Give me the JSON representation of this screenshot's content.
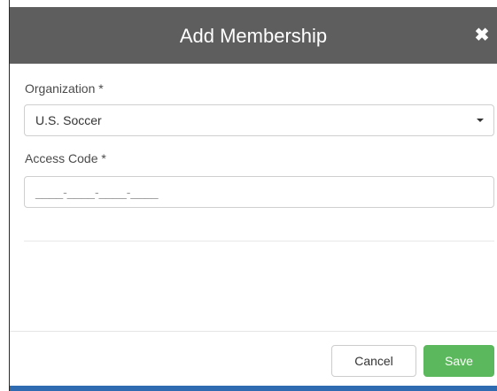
{
  "modal": {
    "title": "Add Membership",
    "close_glyph": "✖",
    "close_icon": "close-icon"
  },
  "form": {
    "organization": {
      "label": "Organization *",
      "selected_value": "U.S. Soccer",
      "caret_icon": "caret-down-icon"
    },
    "access_code": {
      "label": "Access Code *",
      "mask": "____-____-____-____",
      "value": ""
    }
  },
  "footer": {
    "cancel_label": "Cancel",
    "save_label": "Save"
  },
  "colors": {
    "header_bg": "#5e5e5e",
    "save_green": "#5cb85c",
    "accent_blue": "#2f6bb0"
  }
}
